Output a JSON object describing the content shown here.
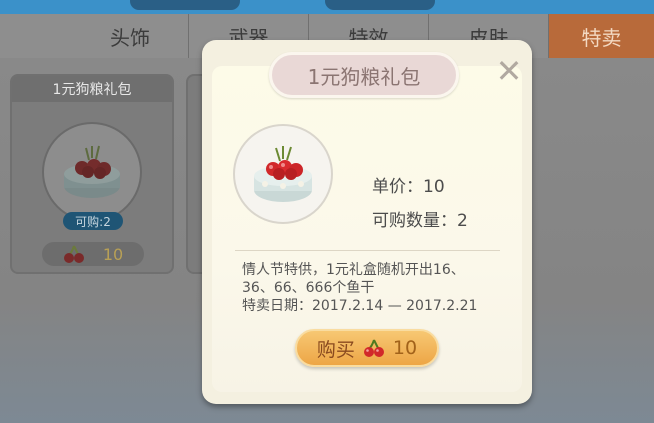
{
  "tabs": [
    {
      "label": "头饰"
    },
    {
      "label": "武器"
    },
    {
      "label": "特效"
    },
    {
      "label": "皮肤"
    },
    {
      "label": "特卖",
      "active": true
    }
  ],
  "card": {
    "title": "1元狗粮礼包",
    "badge": "可购:2",
    "price": "10",
    "icon": "cherry-bowl-icon"
  },
  "dialog": {
    "title": "1元狗粮礼包",
    "close_icon": "close-icon",
    "unit_price": "单价：10",
    "quantity": "可购数量：2",
    "description_line1": "情人节特供，1元礼盒随机开出16、",
    "description_line2": "36、66、666个鱼干",
    "description_line3": "特卖日期：2017.2.14 — 2017.2.21",
    "buy_label": "购买",
    "buy_price": "10",
    "currency_icon": "cherry-icon"
  },
  "colors": {
    "active_tab": "#b86a3a",
    "buy_button": "#eda646",
    "title_pill": "#e9d8d6"
  }
}
